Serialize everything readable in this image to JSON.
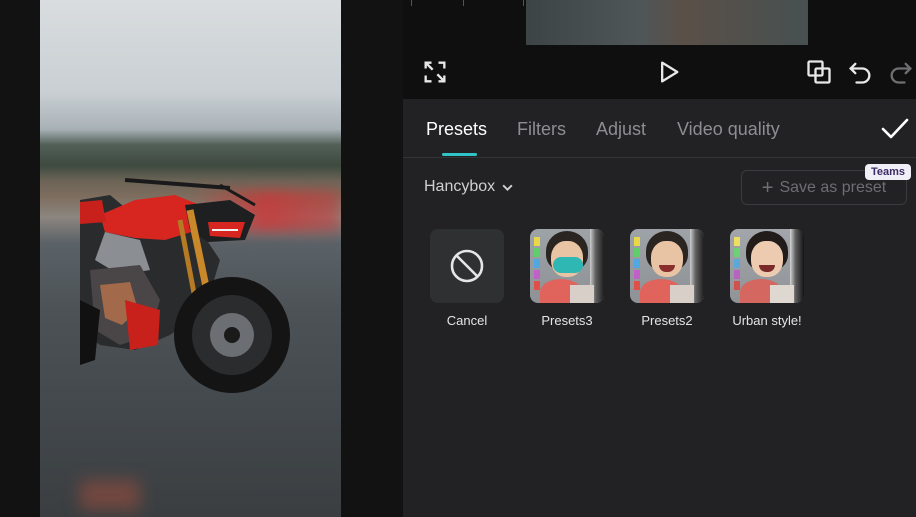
{
  "tabs": [
    {
      "label": "Presets",
      "active": true
    },
    {
      "label": "Filters",
      "active": false
    },
    {
      "label": "Adjust",
      "active": false
    },
    {
      "label": "Video quality",
      "active": false
    }
  ],
  "toolbar": {
    "icons": [
      "fullscreen-icon",
      "play-icon",
      "compare-icon",
      "undo-icon",
      "redo-icon"
    ]
  },
  "presets_bar": {
    "dropdown_label": "Hancybox",
    "save_label": "Save as preset",
    "badge": "Teams"
  },
  "presets": [
    {
      "label": "Cancel",
      "type": "cancel"
    },
    {
      "label": "Presets3",
      "type": "photo",
      "overlay": true
    },
    {
      "label": "Presets2",
      "type": "photo",
      "overlay": false
    },
    {
      "label": "Urban style!",
      "type": "photo",
      "overlay": false
    }
  ],
  "colors": {
    "accent": "#2ec4c8",
    "panel_bg": "#222224",
    "badge_bg": "#f0eef7"
  }
}
